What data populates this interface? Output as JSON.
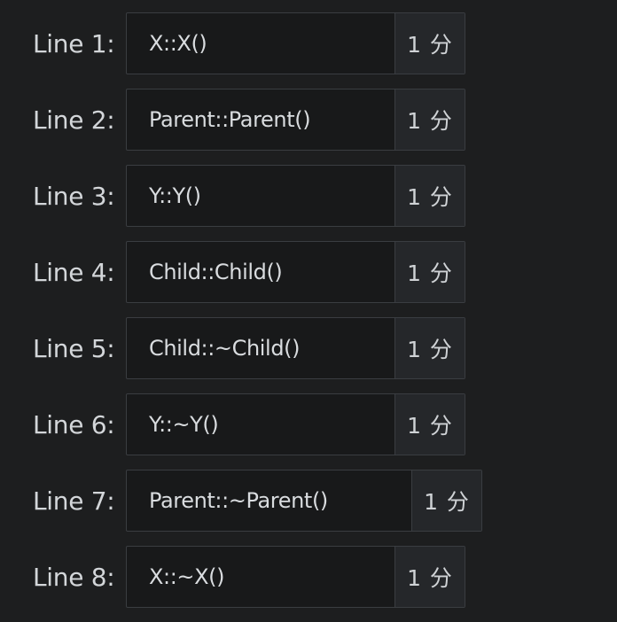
{
  "rows": [
    {
      "label": "Line 1:",
      "value": "X::X()",
      "points": "1 分"
    },
    {
      "label": "Line 2:",
      "value": "Parent::Parent()",
      "points": "1 分"
    },
    {
      "label": "Line 3:",
      "value": "Y::Y()",
      "points": "1 分"
    },
    {
      "label": "Line 4:",
      "value": "Child::Child()",
      "points": "1 分"
    },
    {
      "label": "Line 5:",
      "value": "Child::~Child()",
      "points": "1 分"
    },
    {
      "label": "Line 6:",
      "value": "Y::~Y()",
      "points": "1 分"
    },
    {
      "label": "Line 7:",
      "value": "Parent::~Parent()",
      "points": "1 分"
    },
    {
      "label": "Line 8:",
      "value": "X::~X()",
      "points": "1 分"
    }
  ]
}
